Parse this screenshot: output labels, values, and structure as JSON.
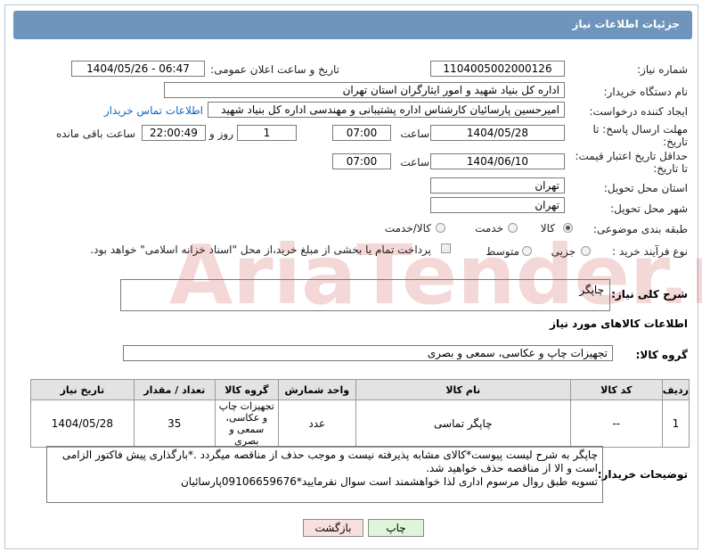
{
  "header": {
    "title": "جزئیات اطلاعات نیاز"
  },
  "form": {
    "need_number_label": "شماره نیاز:",
    "need_number": "1104005002000126",
    "announce_label": "تاریخ و ساعت اعلان عمومی:",
    "announce_value": "1404/05/26 - 06:47",
    "buyer_label": "نام دستگاه خریدار:",
    "buyer_value": "اداره کل بنیاد شهید و امور ایثارگران استان تهران",
    "creator_label": "ایجاد کننده درخواست:",
    "creator_value": "امیرحسین پارسائیان کارشناس اداره پشتیبانی و مهندسی  اداره کل بنیاد شهید",
    "contact_link": "اطلاعات تماس خریدار",
    "deadline_label_1": "مهلت ارسال پاسخ: تا",
    "deadline_label_2": "تاریخ:",
    "deadline_date": "1404/05/28",
    "time_label": "ساعت",
    "deadline_time": "07:00",
    "days_value": "1",
    "days_label": "روز و",
    "remaining_time": "22:00:49",
    "remaining_label": "ساعت باقی مانده",
    "validity_label_1": "حداقل تاریخ اعتبار قیمت:",
    "validity_label_2": "تا تاریخ:",
    "validity_date": "1404/06/10",
    "validity_time": "07:00",
    "province_label": "استان محل تحویل:",
    "province_value": "تهران",
    "city_label": "شهر محل تحویل:",
    "city_value": "تهران",
    "category_label": "طبقه بندی موضوعی:",
    "category_options": [
      "کالا",
      "خدمت",
      "کالا/خدمت"
    ],
    "category_selected": "کالا",
    "process_label": "نوع فرآیند خرید :",
    "process_options": [
      "جزیی",
      "متوسط"
    ],
    "payment_note": "پرداخت تمام یا بخشی از مبلغ خرید،از محل \"اسناد خزانه اسلامی\" خواهد بود."
  },
  "summary": {
    "label": "شرح کلی نیاز:",
    "value": "چاپگر"
  },
  "goods": {
    "section_title": "اطلاعات کالاهای مورد نیاز",
    "group_label": "گروه کالا:",
    "group_value": "تجهیزات چاپ و عکاسی، سمعی و بصری",
    "columns": [
      "ردیف",
      "کد کالا",
      "نام کالا",
      "واحد شمارش",
      "گروه کالا",
      "تعداد / مقدار",
      "تاریخ نیاز"
    ],
    "rows": [
      {
        "row": "1",
        "code": "--",
        "name": "چاپگر تماسی",
        "unit": "عدد",
        "group": "تجهیزات چاپ و عکاسی، سمعی و بصری",
        "qty": "35",
        "date": "1404/05/28"
      }
    ]
  },
  "notes": {
    "label": "توضیحات خریدار:",
    "line1": "چاپگر به شرح لیست پیوست*کالای مشابه پذیرفته نیست و موجب حذف از مناقصه میگردد .*بارگذاری پیش فاکتور الزامی",
    "line2": "است و الا از مناقصه حذف خواهید شد.",
    "line3": "تسویه طبق روال مرسوم اداری لذا خواهشمند است سوال نفرمایید*09106659676پارسائیان"
  },
  "buttons": {
    "print": "چاپ",
    "back": "بازگشت"
  },
  "watermark": {
    "text": "AriaTender.neT"
  },
  "colors": {
    "header": "#6f95bd",
    "link": "#1565c0",
    "print_btn": "#dff5d8",
    "back_btn": "#f9e0e0"
  }
}
